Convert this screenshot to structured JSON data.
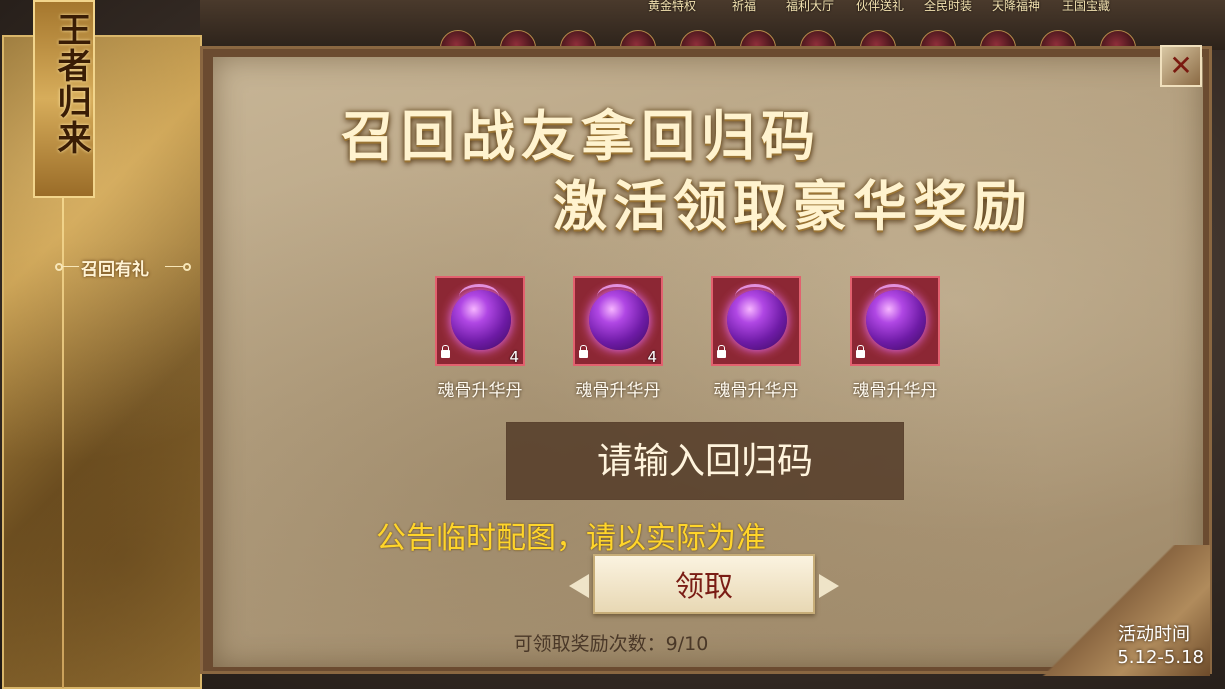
{
  "top_menu": {
    "items": [
      "黄金特权",
      "祈福",
      "福利大厅",
      "伙伴送礼",
      "全民时装",
      "天降福神",
      "王国宝藏"
    ]
  },
  "sidebar": {
    "banner_title": "王者归来",
    "tab_label": "召回有礼"
  },
  "main": {
    "headline_line1": "召回战友拿回归码",
    "headline_line2": "激活领取豪华奖励",
    "rewards": [
      {
        "name": "魂骨升华丹",
        "count": "4",
        "icon": "purple-orb-icon",
        "locked": true
      },
      {
        "name": "魂骨升华丹",
        "count": "4",
        "icon": "purple-orb-icon",
        "locked": true
      },
      {
        "name": "魂骨升华丹",
        "count": "",
        "icon": "purple-orb-icon",
        "locked": true
      },
      {
        "name": "魂骨升华丹",
        "count": "",
        "icon": "purple-orb-icon",
        "locked": true
      }
    ],
    "code_input": {
      "placeholder": "请输入回归码",
      "value": ""
    },
    "notice": "公告临时配图，请以实际为准",
    "claim_button": "领取",
    "claim_count": "可领取奖励次数：9/10"
  },
  "activity_time": {
    "label": "活动时间",
    "range": "5.12-5.18"
  },
  "icons": {
    "close": "close-icon",
    "lock": "lock-icon"
  },
  "colors": {
    "notice": "#ffd52a",
    "claim_text": "#7a1c14",
    "reward_slot": "#b23c4a",
    "headline": "#fff3cf"
  }
}
